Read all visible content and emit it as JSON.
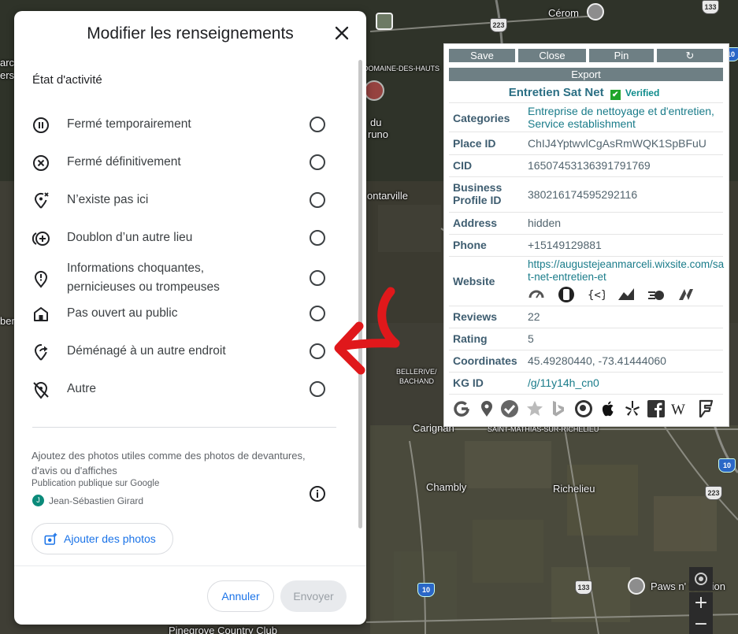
{
  "map": {
    "labels": {
      "cerom": "Cérom",
      "domaine": "DOMAINE-DES-HAUTS",
      "du": "du",
      "runo": "runo",
      "montarville": "ontarville",
      "bellerive": "BELLERIVE/",
      "bachand": "BACHAND",
      "carignan": "Carignan",
      "saint_mathias": "SAINT-MATHIAS-SUR-RICHELIEU",
      "chambly": "Chambly",
      "richelieu": "Richelieu",
      "paws": "Paws n' Session",
      "pinegrove": "Pinegrove Country Club",
      "arc": "arc",
      "ers": "ers",
      "ber": "ber"
    },
    "highways": [
      "223",
      "133",
      "10",
      "133",
      "10",
      "133",
      "10",
      "223"
    ],
    "controls": {
      "zoom_in": "+",
      "zoom_out": "−"
    }
  },
  "dialog": {
    "title": "Modifier les renseignements",
    "section_heading": "État d'activité",
    "options": [
      {
        "label": "Fermé temporairement",
        "icon": "pause-circle-icon"
      },
      {
        "label": "Fermé définitivement",
        "icon": "x-circle-icon"
      },
      {
        "label": "N’existe pas ici",
        "icon": "location-off-icon"
      },
      {
        "label": "Doublon d’un autre lieu",
        "icon": "duplicate-add-icon"
      },
      {
        "label": "Informations choquantes, pernicieuses ou trompeuses",
        "icon": "report-pin-icon"
      },
      {
        "label": "Pas ouvert au public",
        "icon": "home-icon"
      },
      {
        "label": "Déménagé à un autre endroit",
        "icon": "moved-location-icon"
      },
      {
        "label": "Autre",
        "icon": "location-slash-icon"
      }
    ],
    "photo_hint": "Ajoutez des photos utiles comme des photos de devantures, d'avis ou d'affiches",
    "publish_note": "Publication publique sur Google",
    "author_initial": "J",
    "author_name": "Jean-Sébastien Girard",
    "add_photos_label": "Ajouter des photos",
    "cancel_label": "Annuler",
    "send_label": "Envoyer"
  },
  "extension": {
    "buttons": {
      "save": "Save",
      "close": "Close",
      "pin": "Pin",
      "refresh": "↻",
      "export": "Export"
    },
    "business_name": "Entretien Sat Net",
    "verified_label": "Verified",
    "rows": {
      "categories_key": "Categories",
      "categories_val": "Entreprise de nettoyage et d'entretien, Service establishment",
      "place_id_key": "Place ID",
      "place_id_val": "ChIJ4YptwvlCgAsRmWQK1SpBFuU",
      "cid_key": "CID",
      "cid_val": "16507453136391791769",
      "bp_key": "Business Profile ID",
      "bp_val": "380216174595292116",
      "address_key": "Address",
      "address_val": "hidden",
      "phone_key": "Phone",
      "phone_val": "+15149129881",
      "website_key": "Website",
      "website_val": "https://augustejeanmarceli.wixsite.com/sat-net-entretien-et",
      "reviews_key": "Reviews",
      "reviews_val": "22",
      "rating_key": "Rating",
      "rating_val": "5",
      "coords_key": "Coordinates",
      "coords_val": "45.49280440, -73.41444060",
      "kg_key": "KG ID",
      "kg_val": "/g/11y14h_cn0"
    }
  },
  "colors": {
    "annotation_arrow": "#e0181b",
    "primary_blue": "#1a73e8",
    "verified_green": "#1fa52a",
    "ext_button": "#6e7f84"
  }
}
